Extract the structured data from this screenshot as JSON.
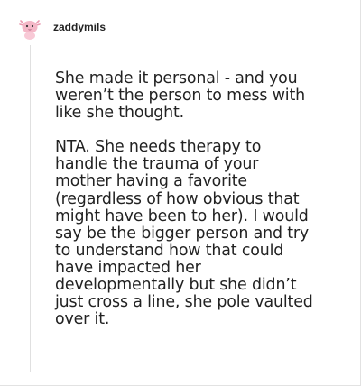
{
  "post": {
    "username": "zaddymils",
    "avatar_icon": "axolotl-avatar-icon",
    "paragraphs": [
      "She made it personal - and you\nweren’t the person to mess with\nlike she thought.",
      "NTA. She needs therapy to\nhandle the trauma of your\nmother having a favorite\n(regardless of how obvious that\nmight have been to her). I would\nsay be the bigger person and try\nto understand how that could\nhave impacted her\ndevelopmentally but she didn’t\njust cross a line, she pole vaulted\nover it."
    ]
  },
  "colors": {
    "text": "#222222",
    "avatar_pink": "#f4b7c7",
    "divider": "#e0e0e0"
  }
}
